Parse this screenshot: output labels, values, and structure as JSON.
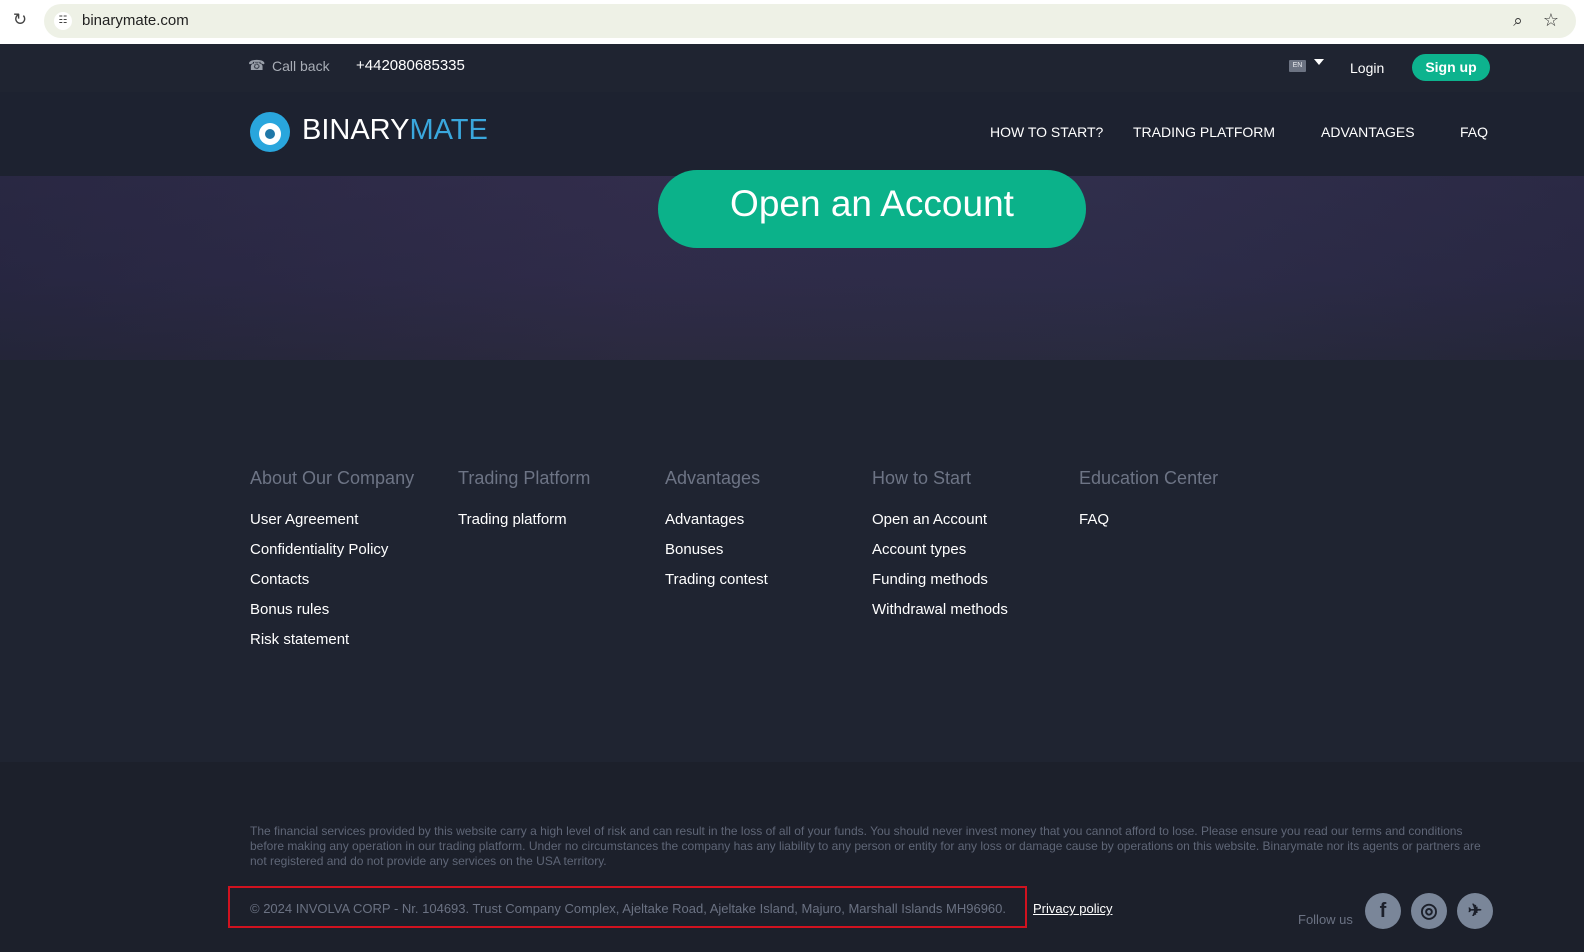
{
  "browser": {
    "url": "binarymate.com"
  },
  "topbar": {
    "callback_label": "Call back",
    "phone": "+442080685335",
    "language": "EN",
    "login_label": "Login",
    "signup_label": "Sign up"
  },
  "logo": {
    "part1": "BINARY",
    "part2": "MATE"
  },
  "nav": {
    "items": [
      "HOW TO START?",
      "TRADING PLATFORM",
      "ADVANTAGES",
      "FAQ"
    ]
  },
  "hero": {
    "cta_label": "Open an Account"
  },
  "footer_columns": [
    {
      "heading": "About Our Company",
      "links": [
        "User Agreement",
        "Confidentiality Policy",
        "Contacts",
        "Bonus rules",
        "Risk statement"
      ]
    },
    {
      "heading": "Trading Platform",
      "links": [
        "Trading platform"
      ]
    },
    {
      "heading": "Advantages",
      "links": [
        "Advantages",
        "Bonuses",
        "Trading contest"
      ]
    },
    {
      "heading": "How to Start",
      "links": [
        "Open an Account",
        "Account types",
        "Funding methods",
        "Withdrawal methods"
      ]
    },
    {
      "heading": "Education Center",
      "links": [
        "FAQ"
      ]
    }
  ],
  "bottom": {
    "disclaimer": "The financial services provided by this website carry a high level of risk and can result in the loss of all of your funds. You should never invest money that you cannot afford to lose. Please ensure you read our terms and conditions before making any operation in our trading platform. Under no circumstances the company has any liability to any person or entity for any loss or damage cause by operations on this website. Binarymate nor its agents or partners are not registered and do not provide any services on the USA territory.",
    "copyright": "© 2024 INVOLVA CORP - Nr. 104693. Trust Company Complex, Ajeltake Road, Ajeltake Island, Majuro, Marshall Islands MH96960.",
    "privacy_label": "Privacy policy",
    "follow_label": "Follow us",
    "social": [
      "facebook-icon",
      "instagram-icon",
      "twitter-icon"
    ]
  },
  "colors": {
    "accent": "#0db38e",
    "brand_blue": "#3aa7dc",
    "highlight_box": "#d0121f"
  }
}
